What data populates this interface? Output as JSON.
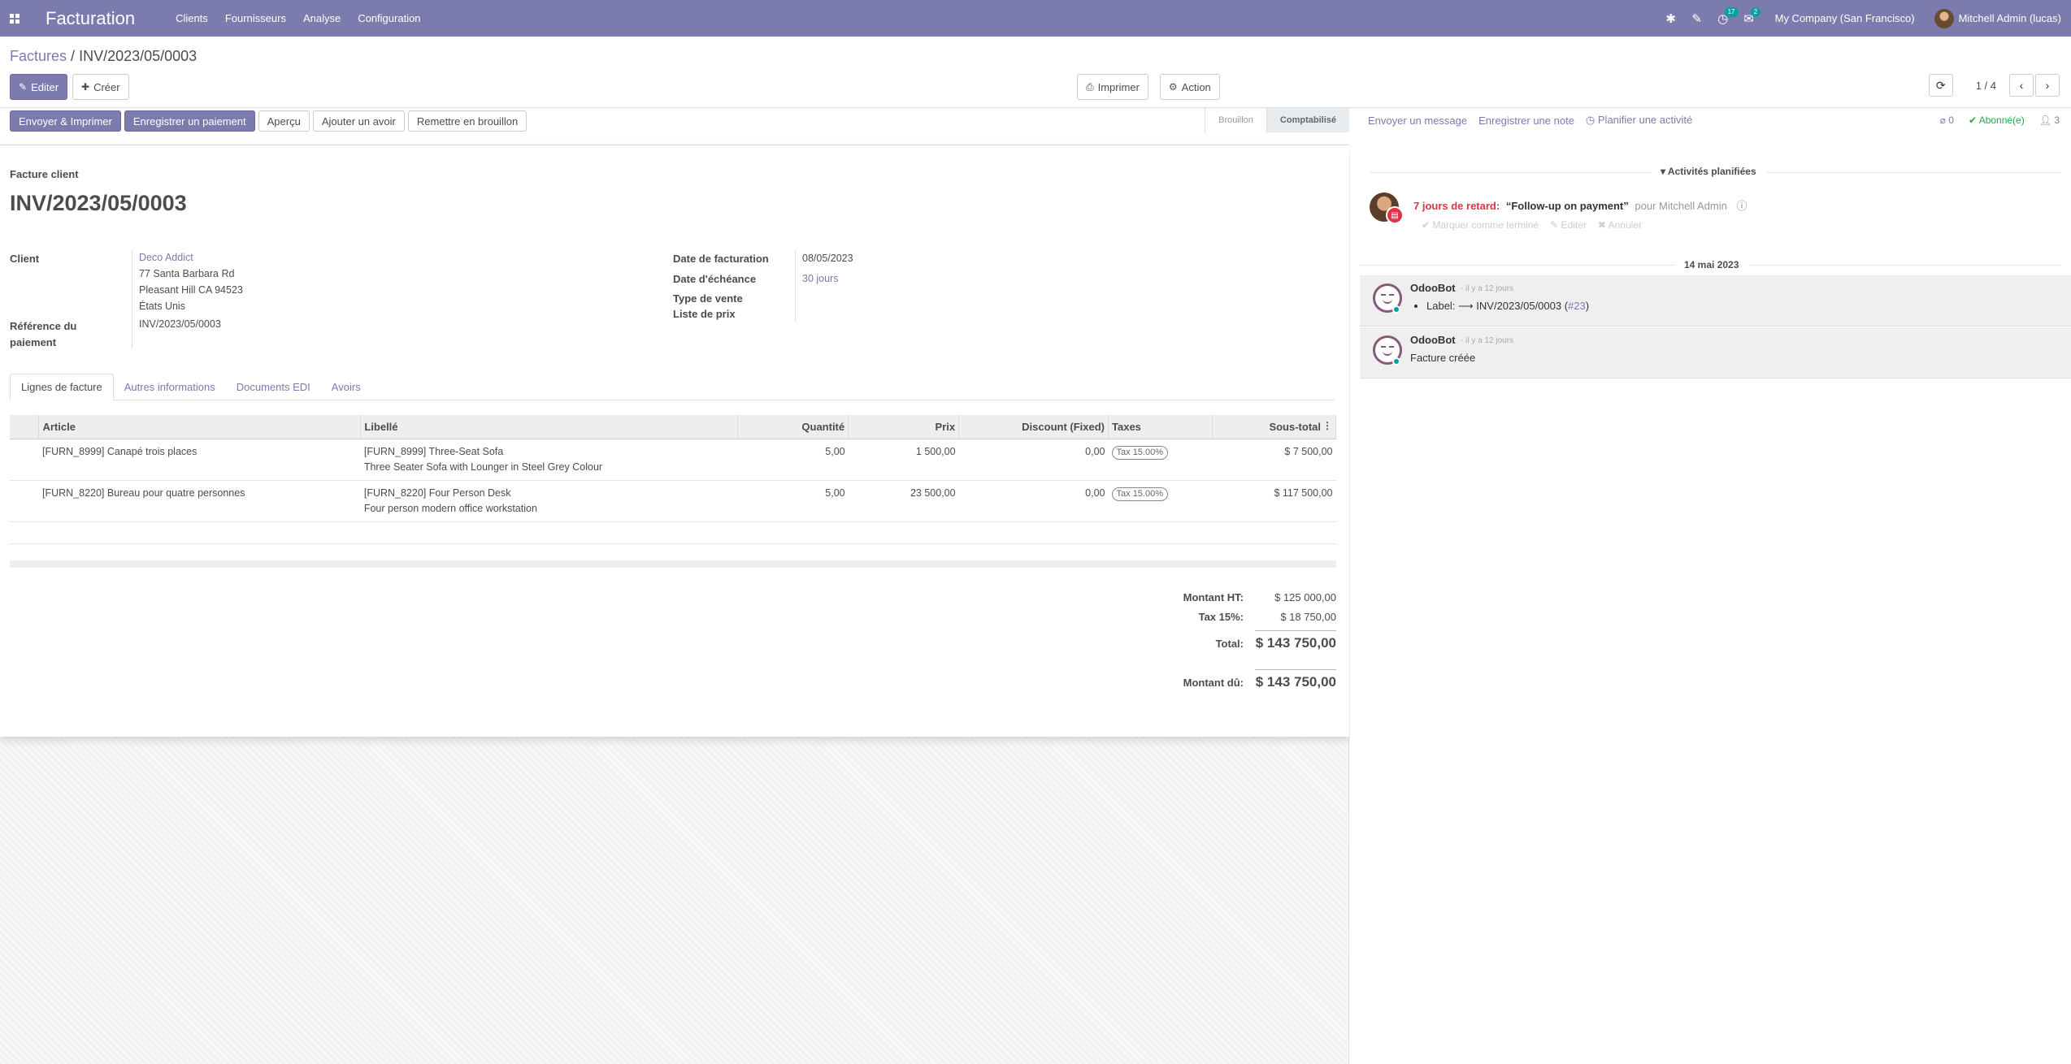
{
  "navbar": {
    "app_title": "Facturation",
    "menu": [
      "Clients",
      "Fournisseurs",
      "Analyse",
      "Configuration"
    ],
    "activity_count": "17",
    "message_count": "2",
    "company": "My Company (San Francisco)",
    "user": "Mitchell Admin (lucas)"
  },
  "breadcrumb": {
    "parent": "Factures",
    "separator": "/",
    "current": "INV/2023/05/0003"
  },
  "control_panel": {
    "edit_label": "Editer",
    "create_label": "Créer",
    "print_label": "Imprimer",
    "action_label": "Action",
    "pager_value": "1 / 4"
  },
  "statusbar": {
    "buttons": [
      "Envoyer & Imprimer",
      "Enregistrer un paiement",
      "Aperçu",
      "Ajouter un avoir",
      "Remettre en brouillon"
    ],
    "stages": [
      "Brouillon",
      "Comptabilisé"
    ]
  },
  "form": {
    "doc_type": "Facture client",
    "doc_name": "INV/2023/05/0003",
    "client_label": "Client",
    "client_name": "Deco Addict",
    "client_address": [
      "77 Santa Barbara Rd",
      "Pleasant Hill CA 94523",
      "États Unis"
    ],
    "payment_ref_label_1": "Référence du",
    "payment_ref_label_2": "paiement",
    "payment_ref": "INV/2023/05/0003",
    "invoice_date_label": "Date de facturation",
    "invoice_date": "08/05/2023",
    "due_date_label": "Date d'échéance",
    "due_date": "30 jours",
    "sale_type_label": "Type de vente",
    "pricelist_label": "Liste de prix"
  },
  "tabs": [
    "Lignes de facture",
    "Autres informations",
    "Documents EDI",
    "Avoirs"
  ],
  "lines": {
    "headers": [
      "Article",
      "Libellé",
      "Quantité",
      "Prix",
      "Discount (Fixed)",
      "Taxes",
      "Sous-total"
    ],
    "rows": [
      {
        "article": "[FURN_8999] Canapé trois places",
        "label1": "[FURN_8999] Three-Seat Sofa",
        "label2": "Three Seater Sofa with Lounger in Steel Grey Colour",
        "qty": "5,00",
        "price": "1 500,00",
        "discount": "0,00",
        "tax": "Tax 15.00%",
        "subtotal": "$ 7 500,00"
      },
      {
        "article": "[FURN_8220] Bureau pour quatre personnes",
        "label1": "[FURN_8220] Four Person Desk",
        "label2": "Four person modern office workstation",
        "qty": "5,00",
        "price": "23 500,00",
        "discount": "0,00",
        "tax": "Tax 15.00%",
        "subtotal": "$ 117 500,00"
      }
    ]
  },
  "totals": {
    "untaxed_label": "Montant HT:",
    "untaxed": "$ 125 000,00",
    "tax_label": "Tax 15%:",
    "tax": "$ 18 750,00",
    "total_label": "Total:",
    "total": "$ 143 750,00",
    "due_label": "Montant dû:",
    "due": "$ 143 750,00"
  },
  "chatter": {
    "send_message": "Envoyer un message",
    "log_note": "Enregistrer une note",
    "schedule_activity": "Planifier une activité",
    "attachments": "0",
    "followed": "Abonné(e)",
    "followers": "3",
    "planned_title": "Activités planifiées",
    "activity": {
      "late": "7 jours de retard:",
      "title": "“Follow-up on payment”",
      "for": "pour Mitchell Admin",
      "mark_done": "Marquer comme terminé",
      "edit": "Editer",
      "cancel": "Annuler"
    },
    "date_sep": "14 mai 2023",
    "messages": [
      {
        "author": "OdooBot",
        "date": "- il y a 12 jours",
        "label_prefix": "Label:",
        "label_value": "INV/2023/05/0003 (",
        "label_ref": "#23",
        "label_suffix": ")"
      },
      {
        "author": "OdooBot",
        "date": "- il y a 12 jours",
        "body": "Facture créée"
      }
    ]
  },
  "colors": {
    "brand": "#7c7bad",
    "late": "#dc3545",
    "followed": "#28a745"
  }
}
